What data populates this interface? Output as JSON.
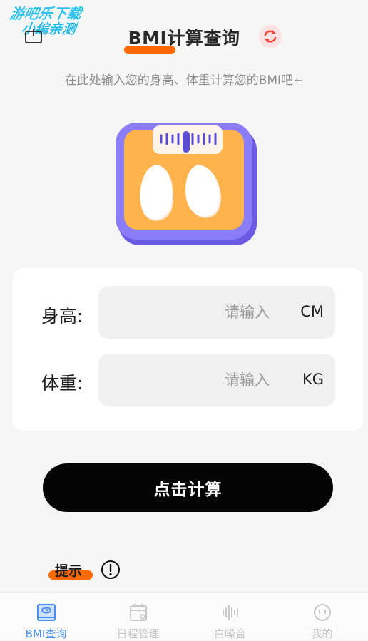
{
  "watermark": {
    "line1": "游吧乐下载",
    "line2": "小编亲测"
  },
  "header": {
    "title": "BMI计算查询"
  },
  "subtitle": "在此处输入您的身高、体重计算您的BMI吧~",
  "form": {
    "height": {
      "label": "身高:",
      "placeholder": "请输入",
      "value": "",
      "unit": "CM"
    },
    "weight": {
      "label": "体重:",
      "placeholder": "请输入",
      "value": "",
      "unit": "KG"
    }
  },
  "calculate_label": "点击计算",
  "tip": {
    "label": "提示"
  },
  "colors": {
    "accent": "#ff6a00",
    "tab_active": "#4a8ff0",
    "scale_purple": "#7d6cf3",
    "scale_orange": "#ffb34d"
  },
  "tabs": [
    {
      "label": "BMI查询",
      "icon": "scale-icon",
      "active": true
    },
    {
      "label": "日程管理",
      "icon": "calendar-icon",
      "active": false
    },
    {
      "label": "白噪音",
      "icon": "sound-wave-icon",
      "active": false
    },
    {
      "label": "我的",
      "icon": "smiley-icon",
      "active": false
    }
  ]
}
